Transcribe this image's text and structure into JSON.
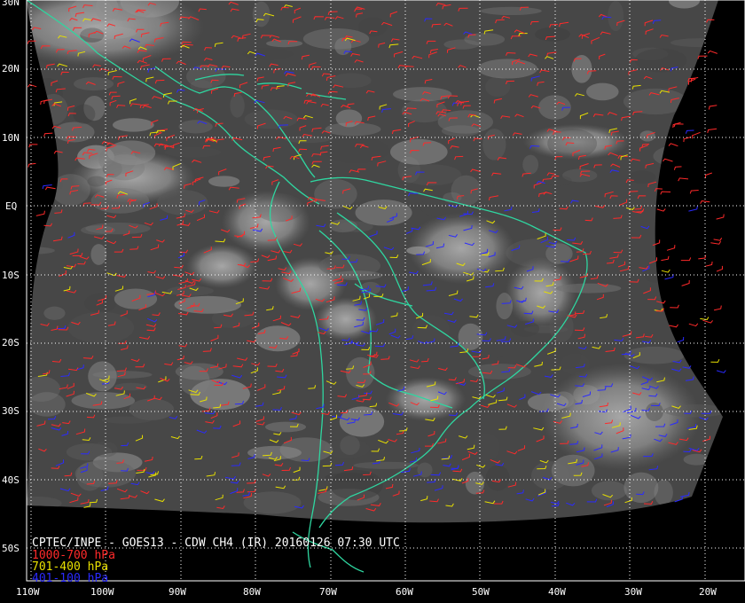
{
  "map": {
    "caption": "CPTEC/INPE - GOES13 - CDW CH4 (IR) 20160126 07:30 UTC",
    "legend": [
      {
        "label": "1000-700 hPa",
        "color": "#ff2a2a"
      },
      {
        "label": "701-400 hPa",
        "color": "#e8e000"
      },
      {
        "label": "401-100 hPa",
        "color": "#2a2aff"
      }
    ],
    "lat_labels": [
      "30N",
      "20N",
      "10N",
      "EQ",
      "10S",
      "20S",
      "30S",
      "40S",
      "50S"
    ],
    "lon_labels": [
      "110W",
      "100W",
      "90W",
      "80W",
      "70W",
      "60W",
      "50W",
      "40W",
      "30W",
      "20W"
    ],
    "colors": {
      "background": "#000000",
      "coast": "#2fd6a0",
      "grid": "#ffffff",
      "cloud_dark": "#3a3a3a",
      "cloud_bright": "#f2f2f2"
    }
  }
}
